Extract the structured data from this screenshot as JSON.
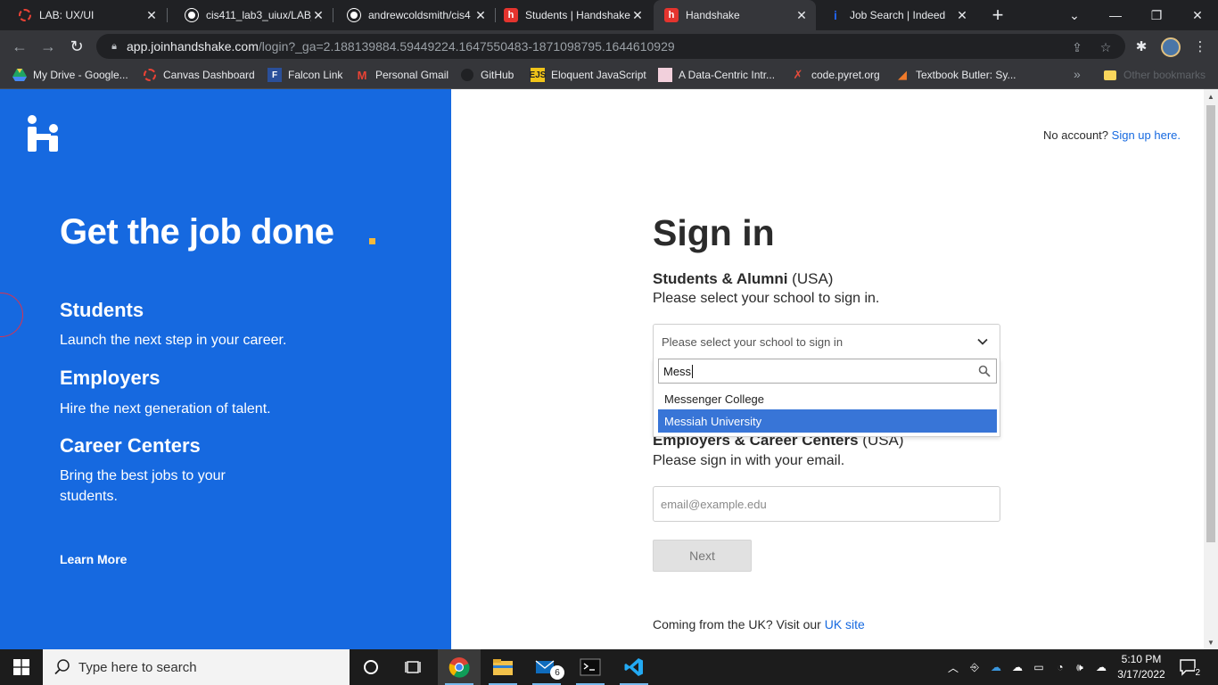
{
  "browser": {
    "tabs": [
      {
        "title": "LAB: UX/UI",
        "favicon": "canvas-icon",
        "active": false
      },
      {
        "title": "cis411_lab3_uiux/LAB_",
        "favicon": "github-icon",
        "active": false
      },
      {
        "title": "andrewcoldsmith/cis4",
        "favicon": "github-icon",
        "active": false
      },
      {
        "title": "Students | Handshake",
        "favicon": "handshake-icon",
        "active": false
      },
      {
        "title": "Handshake",
        "favicon": "handshake-icon",
        "active": true
      },
      {
        "title": "Job Search | Indeed",
        "favicon": "indeed-icon",
        "active": false
      }
    ],
    "address": {
      "host": "app.joinhandshake.com",
      "path": "/login?_ga=2.188139884.59449224.1647550483-1871098795.1644610929"
    },
    "bookmarks": [
      {
        "label": "My Drive - Google...",
        "icon": "google-drive-icon"
      },
      {
        "label": "Canvas Dashboard",
        "icon": "canvas-icon"
      },
      {
        "label": "Falcon Link",
        "icon": "falcon-icon"
      },
      {
        "label": "Personal Gmail",
        "icon": "gmail-icon"
      },
      {
        "label": "GitHub",
        "icon": "github-icon"
      },
      {
        "label": "Eloquent JavaScript",
        "icon": "ejs-icon"
      },
      {
        "label": "A Data-Centric Intr...",
        "icon": "page-icon"
      },
      {
        "label": "code.pyret.org",
        "icon": "pyret-icon"
      },
      {
        "label": "Textbook Butler: Sy...",
        "icon": "textbook-icon"
      }
    ],
    "other_bookmarks": "Other bookmarks"
  },
  "left_panel": {
    "hero": "Get the job done",
    "sections": [
      {
        "title": "Students",
        "text": "Launch the next step in your career."
      },
      {
        "title": "Employers",
        "text": "Hire the next generation of talent."
      },
      {
        "title": "Career Centers",
        "text": "Bring the best jobs to your students."
      }
    ],
    "learn_more": "Learn More",
    "brand_color": "#1669e0",
    "accent_color": "#f5b93a"
  },
  "signin": {
    "no_account": "No account?",
    "sign_up_link": "Sign up here.",
    "title": "Sign in",
    "students_title": "Students & Alumni",
    "students_region": "(USA)",
    "students_sub": "Please select your school to sign in.",
    "school_placeholder": "Please select your school to sign in",
    "school_search_value": "Mess",
    "school_options": [
      {
        "label": "Messenger College",
        "highlighted": false
      },
      {
        "label": "Messiah University",
        "highlighted": true
      }
    ],
    "employers_title": "Employers & Career Centers",
    "employers_region": "(USA)",
    "employers_sub": "Please sign in with your email.",
    "email_placeholder": "email@example.edu",
    "next_label": "Next",
    "uk_text": "Coming from the UK? Visit our",
    "uk_link": "UK site"
  },
  "taskbar": {
    "search_placeholder": "Type here to search",
    "mail_badge": "6",
    "time": "5:10 PM",
    "date": "3/17/2022",
    "notification_count": "2"
  }
}
